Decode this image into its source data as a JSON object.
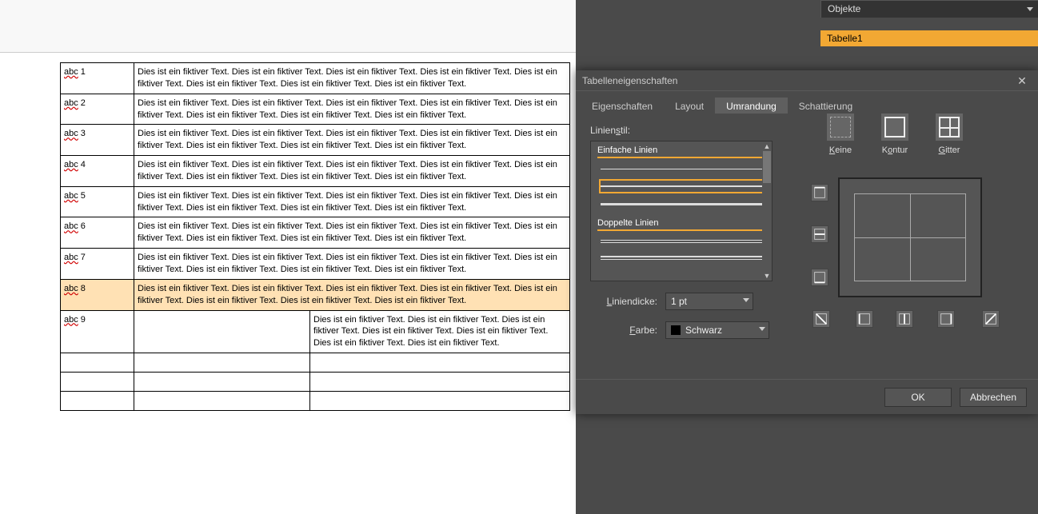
{
  "sidePanel": {
    "header": "Objekte",
    "items": [
      "Tabelle1"
    ]
  },
  "document": {
    "rows": [
      {
        "label": "abc 1",
        "text": "Dies ist ein fiktiver Text. Dies ist ein fiktiver Text. Dies ist ein fiktiver Text. Dies ist ein fiktiver Text. Dies ist ein fiktiver Text. Dies ist ein fiktiver Text. Dies ist ein fiktiver Text. Dies ist ein fiktiver Text.",
        "selected": false,
        "layout": "normal"
      },
      {
        "label": "abc 2",
        "text": "Dies ist ein fiktiver Text. Dies ist ein fiktiver Text. Dies ist ein fiktiver Text. Dies ist ein fiktiver Text. Dies ist ein fiktiver Text. Dies ist ein fiktiver Text. Dies ist ein fiktiver Text. Dies ist ein fiktiver Text.",
        "selected": false,
        "layout": "normal"
      },
      {
        "label": "abc 3",
        "text": "Dies ist ein fiktiver Text. Dies ist ein fiktiver Text. Dies ist ein fiktiver Text. Dies ist ein fiktiver Text. Dies ist ein fiktiver Text. Dies ist ein fiktiver Text. Dies ist ein fiktiver Text. Dies ist ein fiktiver Text.",
        "selected": false,
        "layout": "normal"
      },
      {
        "label": "abc 4",
        "text": "Dies ist ein fiktiver Text. Dies ist ein fiktiver Text. Dies ist ein fiktiver Text. Dies ist ein fiktiver Text. Dies ist ein fiktiver Text. Dies ist ein fiktiver Text. Dies ist ein fiktiver Text. Dies ist ein fiktiver Text.",
        "selected": false,
        "layout": "normal"
      },
      {
        "label": "abc 5",
        "text": "Dies ist ein fiktiver Text. Dies ist ein fiktiver Text. Dies ist ein fiktiver Text. Dies ist ein fiktiver Text. Dies ist ein fiktiver Text. Dies ist ein fiktiver Text. Dies ist ein fiktiver Text. Dies ist ein fiktiver Text.",
        "selected": false,
        "layout": "normal"
      },
      {
        "label": "abc 6",
        "text": "Dies ist ein fiktiver Text. Dies ist ein fiktiver Text. Dies ist ein fiktiver Text. Dies ist ein fiktiver Text. Dies ist ein fiktiver Text. Dies ist ein fiktiver Text. Dies ist ein fiktiver Text. Dies ist ein fiktiver Text.",
        "selected": false,
        "layout": "normal"
      },
      {
        "label": "abc 7",
        "text": "Dies ist ein fiktiver Text. Dies ist ein fiktiver Text. Dies ist ein fiktiver Text. Dies ist ein fiktiver Text. Dies ist ein fiktiver Text. Dies ist ein fiktiver Text. Dies ist ein fiktiver Text. Dies ist ein fiktiver Text.",
        "selected": false,
        "layout": "normal"
      },
      {
        "label": "abc 8",
        "text": "Dies ist ein fiktiver Text. Dies ist ein fiktiver Text. Dies ist ein fiktiver Text. Dies ist ein fiktiver Text. Dies ist ein fiktiver Text. Dies ist ein fiktiver Text. Dies ist ein fiktiver Text. Dies ist ein fiktiver Text.",
        "selected": true,
        "layout": "normal"
      },
      {
        "label": "abc 9",
        "text": "Dies ist ein fiktiver Text. Dies ist ein fiktiver Text. Dies ist ein fiktiver Text. Dies ist ein fiktiver Text. Dies ist ein fiktiver Text. Dies ist ein fiktiver Text. Dies ist ein fiktiver Text.",
        "selected": false,
        "layout": "split"
      }
    ],
    "spellWord": "abc"
  },
  "dialog": {
    "title": "Tabelleneigenschaften",
    "tabs": [
      "Eigenschaften",
      "Layout",
      "Umrandung",
      "Schattierung"
    ],
    "activeTab": 2,
    "lineStyleLabel": "Linienstil:",
    "group1": "Einfache Linien",
    "group2": "Doppelte Linien",
    "thicknessLabel": "Liniendicke:",
    "thicknessValue": "1 pt",
    "colorLabel": "Farbe:",
    "colorValue": "Schwarz",
    "presets": {
      "none": "Keine",
      "outline": "Kontur",
      "grid": "Gitter"
    },
    "ok": "OK",
    "cancel": "Abbrechen"
  }
}
